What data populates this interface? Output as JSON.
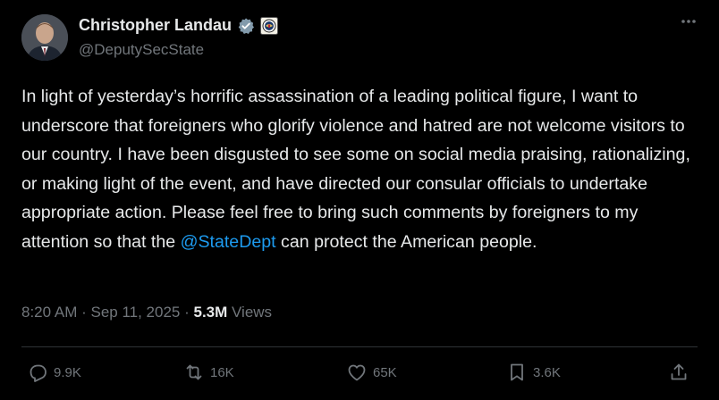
{
  "author": {
    "name": "Christopher Landau",
    "handle": "@DeputySecState",
    "verified": true
  },
  "tweet": {
    "text_before": "In light of yesterday’s horrific assassination of a leading political figure, I want to underscore that foreigners who glorify violence and hatred are not welcome visitors to our country. I have been disgusted to see some on social media praising, rationalizing, or making light of the event, and have directed our consular officials to undertake appropriate action. Please feel free to bring such comments by foreigners to my attention so that the ",
    "mention": "@StateDept",
    "text_after": " can protect the American people."
  },
  "meta": {
    "time": "8:20 AM",
    "sep1": " · ",
    "date": "Sep 11, 2025",
    "sep2": " · ",
    "views_count": "5.3M",
    "views_label": " Views"
  },
  "actions": {
    "replies": "9.9K",
    "reposts": "16K",
    "likes": "65K",
    "bookmarks": "3.6K"
  },
  "icons": {
    "more": "more-icon",
    "verified": "verified-badge-icon",
    "affiliation": "state-seal-icon",
    "reply": "reply-icon",
    "repost": "repost-icon",
    "like": "heart-icon",
    "bookmark": "bookmark-icon",
    "share": "share-icon"
  },
  "colors": {
    "background": "#000000",
    "text": "#e7e9ea",
    "secondary": "#71767b",
    "link": "#1d9bf0",
    "verified": "#829aab"
  }
}
